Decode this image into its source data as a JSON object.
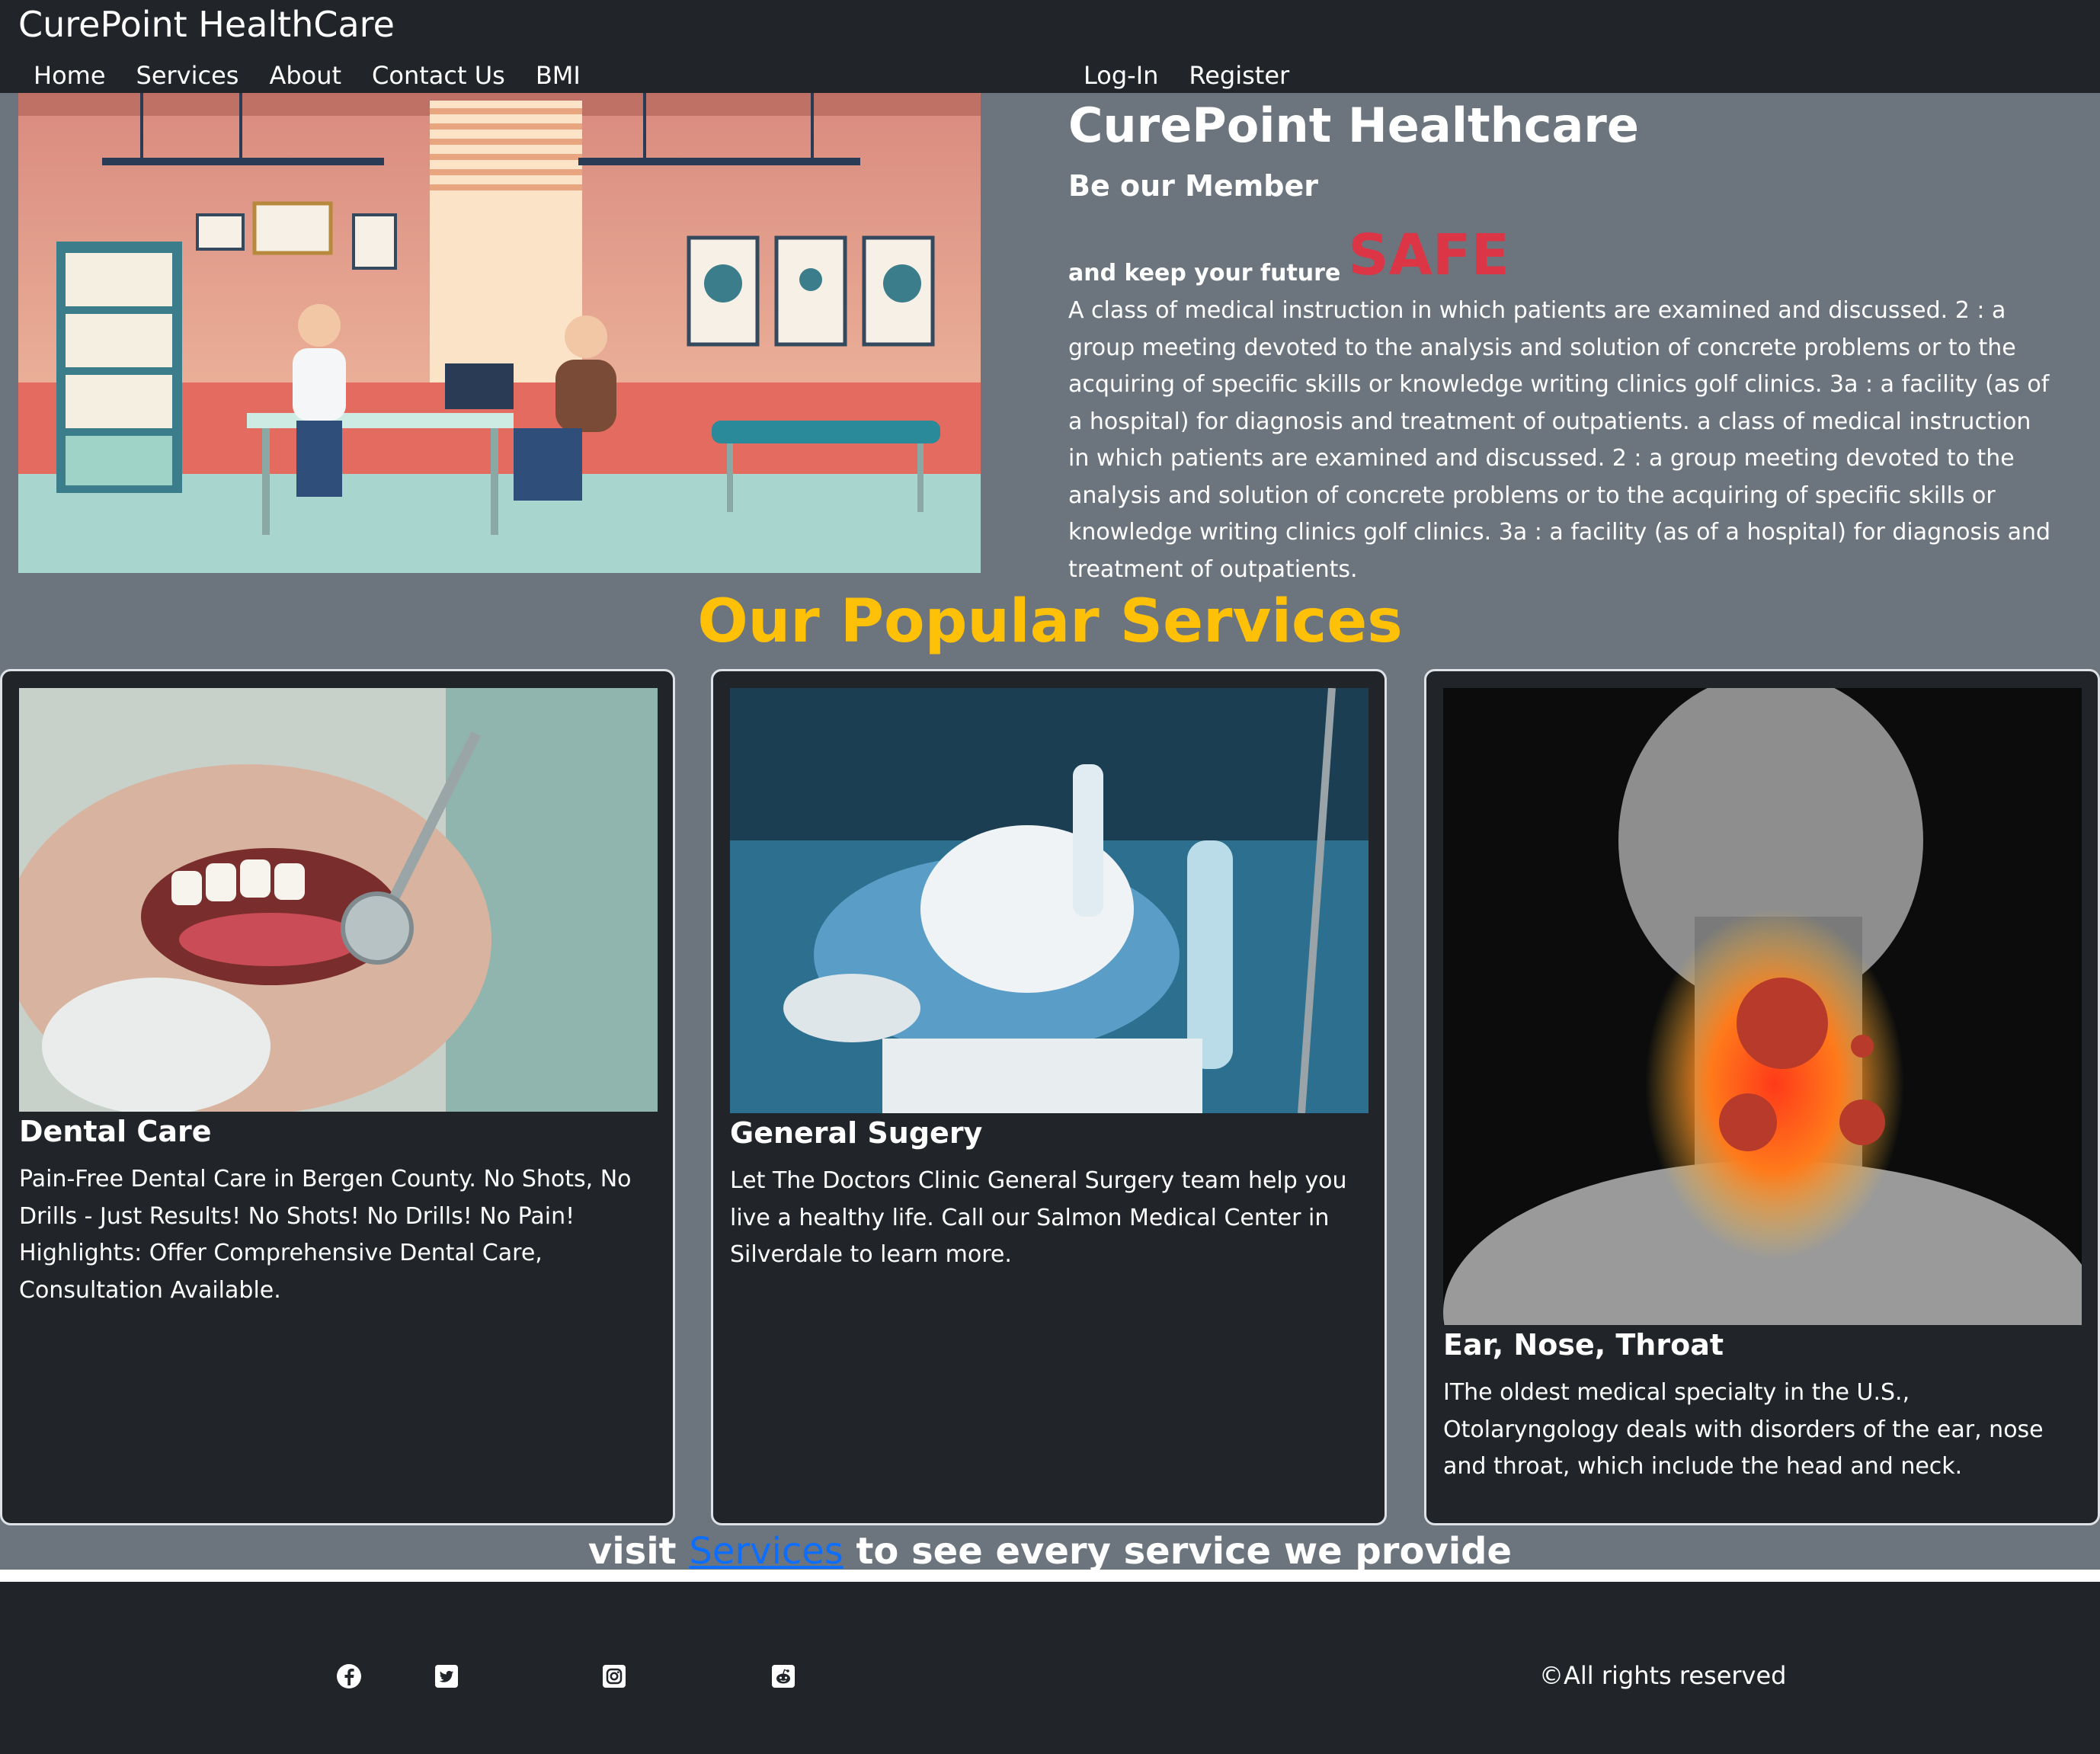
{
  "navbar": {
    "brand": "CurePoint HealthCare",
    "links": [
      "Home",
      "Services",
      "About",
      "Contact Us",
      "BMI"
    ],
    "auth": [
      "Log-In",
      "Register"
    ]
  },
  "hero": {
    "title": "CurePoint Healthcare",
    "subtitle": "Be our Member",
    "keep_text": "and keep your future",
    "highlight": "SAFE",
    "paragraph": "A class of medical instruction in which patients are examined and discussed. 2 : a group meeting devoted to the analysis and solution of concrete problems or to the acquiring of specific skills or knowledge writing clinics golf clinics. 3a : a facility (as of a hospital) for diagnosis and treatment of outpatients. a class of medical instruction in which patients are examined and discussed. 2 : a group meeting devoted to the analysis and solution of concrete problems or to the acquiring of specific skills or knowledge writing clinics golf clinics. 3a : a facility (as of a hospital) for diagnosis and treatment of outpatients."
  },
  "services": {
    "heading": "Our Popular Services",
    "cards": [
      {
        "title": "Dental Care",
        "text": "Pain-Free Dental Care in Bergen County. No Shots, No Drills - Just Results! No Shots! No Drills! No Pain! Highlights: Offer Comprehensive Dental Care, Consultation Available."
      },
      {
        "title": "General Sugery",
        "text": "Let The Doctors Clinic General Surgery team help you live a healthy life. Call our Salmon Medical Center in Silverdale to learn more."
      },
      {
        "title": "Ear, Nose, Throat",
        "text": "IThe oldest medical specialty in the U.S., Otolaryngology deals with disorders of the ear, nose and throat, which include the head and neck."
      }
    ],
    "visit_prefix": "visit",
    "visit_link": "Services",
    "visit_suffix": "to see every service we provide"
  },
  "footer": {
    "social_icons": [
      "facebook-icon",
      "twitter-icon",
      "instagram-icon",
      "reddit-icon"
    ],
    "rights": "©All rights reserved"
  },
  "colors": {
    "page_bg": "#6c757d",
    "dark": "#212529",
    "accent_yellow": "#ffc107",
    "accent_red": "#dc3545",
    "link_blue": "#0d6efd"
  }
}
